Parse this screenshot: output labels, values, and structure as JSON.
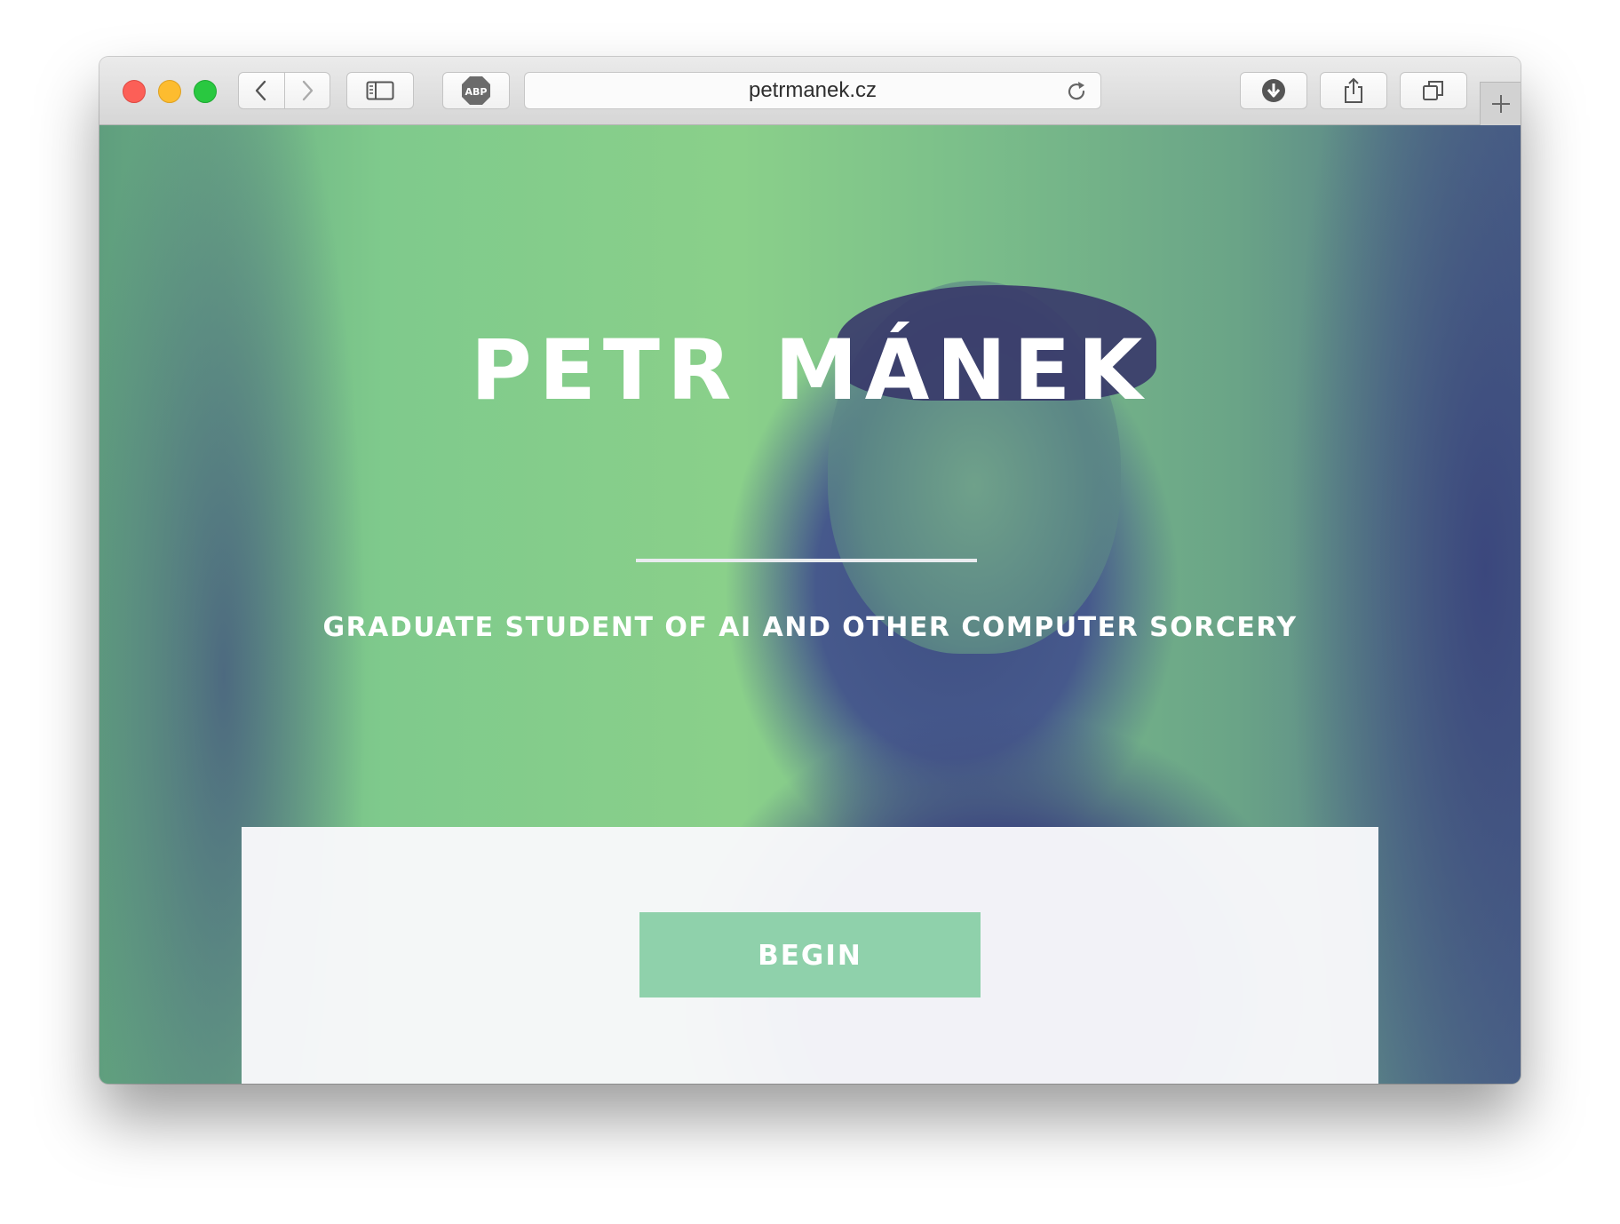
{
  "browser": {
    "url": "petrmanek.cz",
    "icons": {
      "back": "chevron-left-icon",
      "forward": "chevron-right-icon",
      "sidebar": "sidebar-icon",
      "adblock": "abp-icon",
      "reload": "reload-icon",
      "downloads": "download-icon",
      "share": "share-icon",
      "tabs": "tabs-overview-icon",
      "new_tab": "plus-icon"
    },
    "abp_label": "ABP"
  },
  "hero": {
    "title": "PETR MÁNEK",
    "subtitle": "GRADUATE STUDENT OF AI AND OTHER COMPUTER SORCERY",
    "begin_label": "BEGIN"
  },
  "colors": {
    "accent_green": "#8fd1ab",
    "duotone_green": "#8ad08a",
    "duotone_blue": "#3f4f83",
    "panel": "#f8f8fb"
  }
}
